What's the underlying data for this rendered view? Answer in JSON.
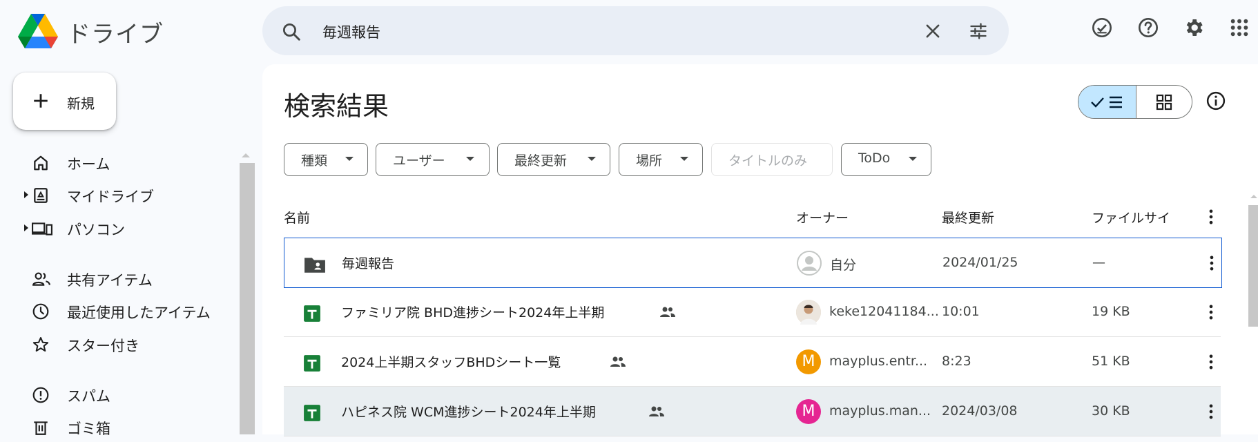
{
  "app": {
    "title": "ドライブ"
  },
  "search": {
    "query": "毎週報告"
  },
  "new_button": {
    "label": "新規"
  },
  "sidebar": {
    "items": [
      {
        "label": "ホーム",
        "icon": "home-icon"
      },
      {
        "label": "マイドライブ",
        "icon": "my-drive-icon"
      },
      {
        "label": "パソコン",
        "icon": "computers-icon"
      },
      {
        "label": "共有アイテム",
        "icon": "people-icon"
      },
      {
        "label": "最近使用したアイテム",
        "icon": "clock-icon"
      },
      {
        "label": "スター付き",
        "icon": "star-icon"
      },
      {
        "label": "スパム",
        "icon": "spam-icon"
      },
      {
        "label": "ゴミ箱",
        "icon": "trash-icon"
      }
    ]
  },
  "main": {
    "title": "検索結果",
    "filters": [
      {
        "label": "種類"
      },
      {
        "label": "ユーザー"
      },
      {
        "label": "最終更新"
      },
      {
        "label": "場所"
      },
      {
        "label": "タイトルのみ"
      },
      {
        "label": "ToDo"
      }
    ],
    "columns": {
      "name": "名前",
      "owner": "オーナー",
      "modified": "最終更新",
      "size": "ファイルサイ"
    },
    "rows": [
      {
        "name": "毎週報告",
        "type": "shared-folder",
        "owner": "自分",
        "modified": "2024/01/25",
        "size": "—",
        "shared": false,
        "avatar": "",
        "avatar_color": "#c4c7c5"
      },
      {
        "name": "ファミリア院 BHD進捗シート2024年上半期",
        "type": "sheet",
        "owner": "keke12041184...",
        "modified": "10:01",
        "size": "19 KB",
        "shared": true,
        "avatar": "",
        "avatar_color": "#b9a48c"
      },
      {
        "name": "2024上半期スタッフBHDシート一覧",
        "type": "sheet",
        "owner": "mayplus.entr...",
        "modified": "8:23",
        "size": "51 KB",
        "shared": true,
        "avatar": "M",
        "avatar_color": "#f29900"
      },
      {
        "name": "ハピネス院 WCM進捗シート2024年上半期",
        "type": "sheet",
        "owner": "mayplus.man...",
        "modified": "2024/03/08",
        "size": "30 KB",
        "shared": true,
        "avatar": "M",
        "avatar_color": "#e52592"
      }
    ]
  },
  "colors": {
    "accent": "#0b57d0",
    "selected_view": "#c2e7ff",
    "sheet_green": "#188038"
  }
}
